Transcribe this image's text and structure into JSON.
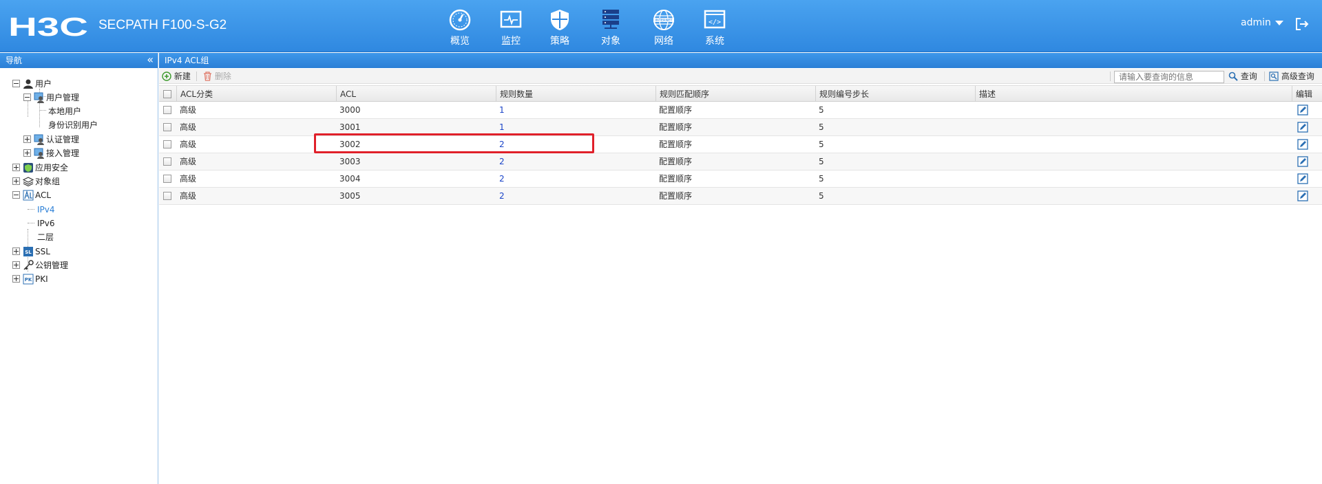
{
  "header": {
    "logo_text": "H3C",
    "product": "SECPATH F100-S-G2",
    "nav": [
      {
        "label": "概览",
        "icon": "gauge-icon"
      },
      {
        "label": "监控",
        "icon": "monitor-icon"
      },
      {
        "label": "策略",
        "icon": "shield-icon"
      },
      {
        "label": "对象",
        "icon": "server-stack-icon"
      },
      {
        "label": "网络",
        "icon": "globe-internet-icon"
      },
      {
        "label": "系统",
        "icon": "code-window-icon"
      }
    ],
    "globe_text": "INTERNET",
    "code_text": "</>",
    "user": "admin",
    "logout_icon": "logout-icon"
  },
  "sidebar": {
    "title": "导航",
    "collapse": "«",
    "items": [
      {
        "label": "用户"
      },
      {
        "label": "用户管理"
      },
      {
        "label": "本地用户"
      },
      {
        "label": "身份识别用户"
      },
      {
        "label": "认证管理"
      },
      {
        "label": "接入管理"
      },
      {
        "label": "应用安全"
      },
      {
        "label": "对象组"
      },
      {
        "label": "ACL"
      },
      {
        "label": "IPv4"
      },
      {
        "label": "IPv6"
      },
      {
        "label": "二层"
      },
      {
        "label": "SSL"
      },
      {
        "label": "公钥管理"
      },
      {
        "label": "PKI"
      }
    ]
  },
  "main": {
    "title": "IPv4 ACL组",
    "toolbar": {
      "new": "新建",
      "delete": "删除",
      "search_placeholder": "请输入要查询的信息",
      "search": "查询",
      "advanced_search": "高级查询"
    },
    "columns": [
      "ACL分类",
      "ACL",
      "规则数量",
      "规则匹配顺序",
      "规则编号步长",
      "描述",
      "编辑"
    ],
    "rows": [
      {
        "category": "高级",
        "acl": "3000",
        "rule_count": "1",
        "order": "配置顺序",
        "step": "5",
        "desc": ""
      },
      {
        "category": "高级",
        "acl": "3001",
        "rule_count": "1",
        "order": "配置顺序",
        "step": "5",
        "desc": ""
      },
      {
        "category": "高级",
        "acl": "3002",
        "rule_count": "2",
        "order": "配置顺序",
        "step": "5",
        "desc": ""
      },
      {
        "category": "高级",
        "acl": "3003",
        "rule_count": "2",
        "order": "配置顺序",
        "step": "5",
        "desc": ""
      },
      {
        "category": "高级",
        "acl": "3004",
        "rule_count": "2",
        "order": "配置顺序",
        "step": "5",
        "desc": ""
      },
      {
        "category": "高级",
        "acl": "3005",
        "rule_count": "2",
        "order": "配置顺序",
        "step": "5",
        "desc": ""
      }
    ],
    "highlighted_row": 2
  },
  "colors": {
    "header_blue": "#2f88e0",
    "highlight_red": "#e0202a",
    "link_blue": "#1a44c8"
  }
}
